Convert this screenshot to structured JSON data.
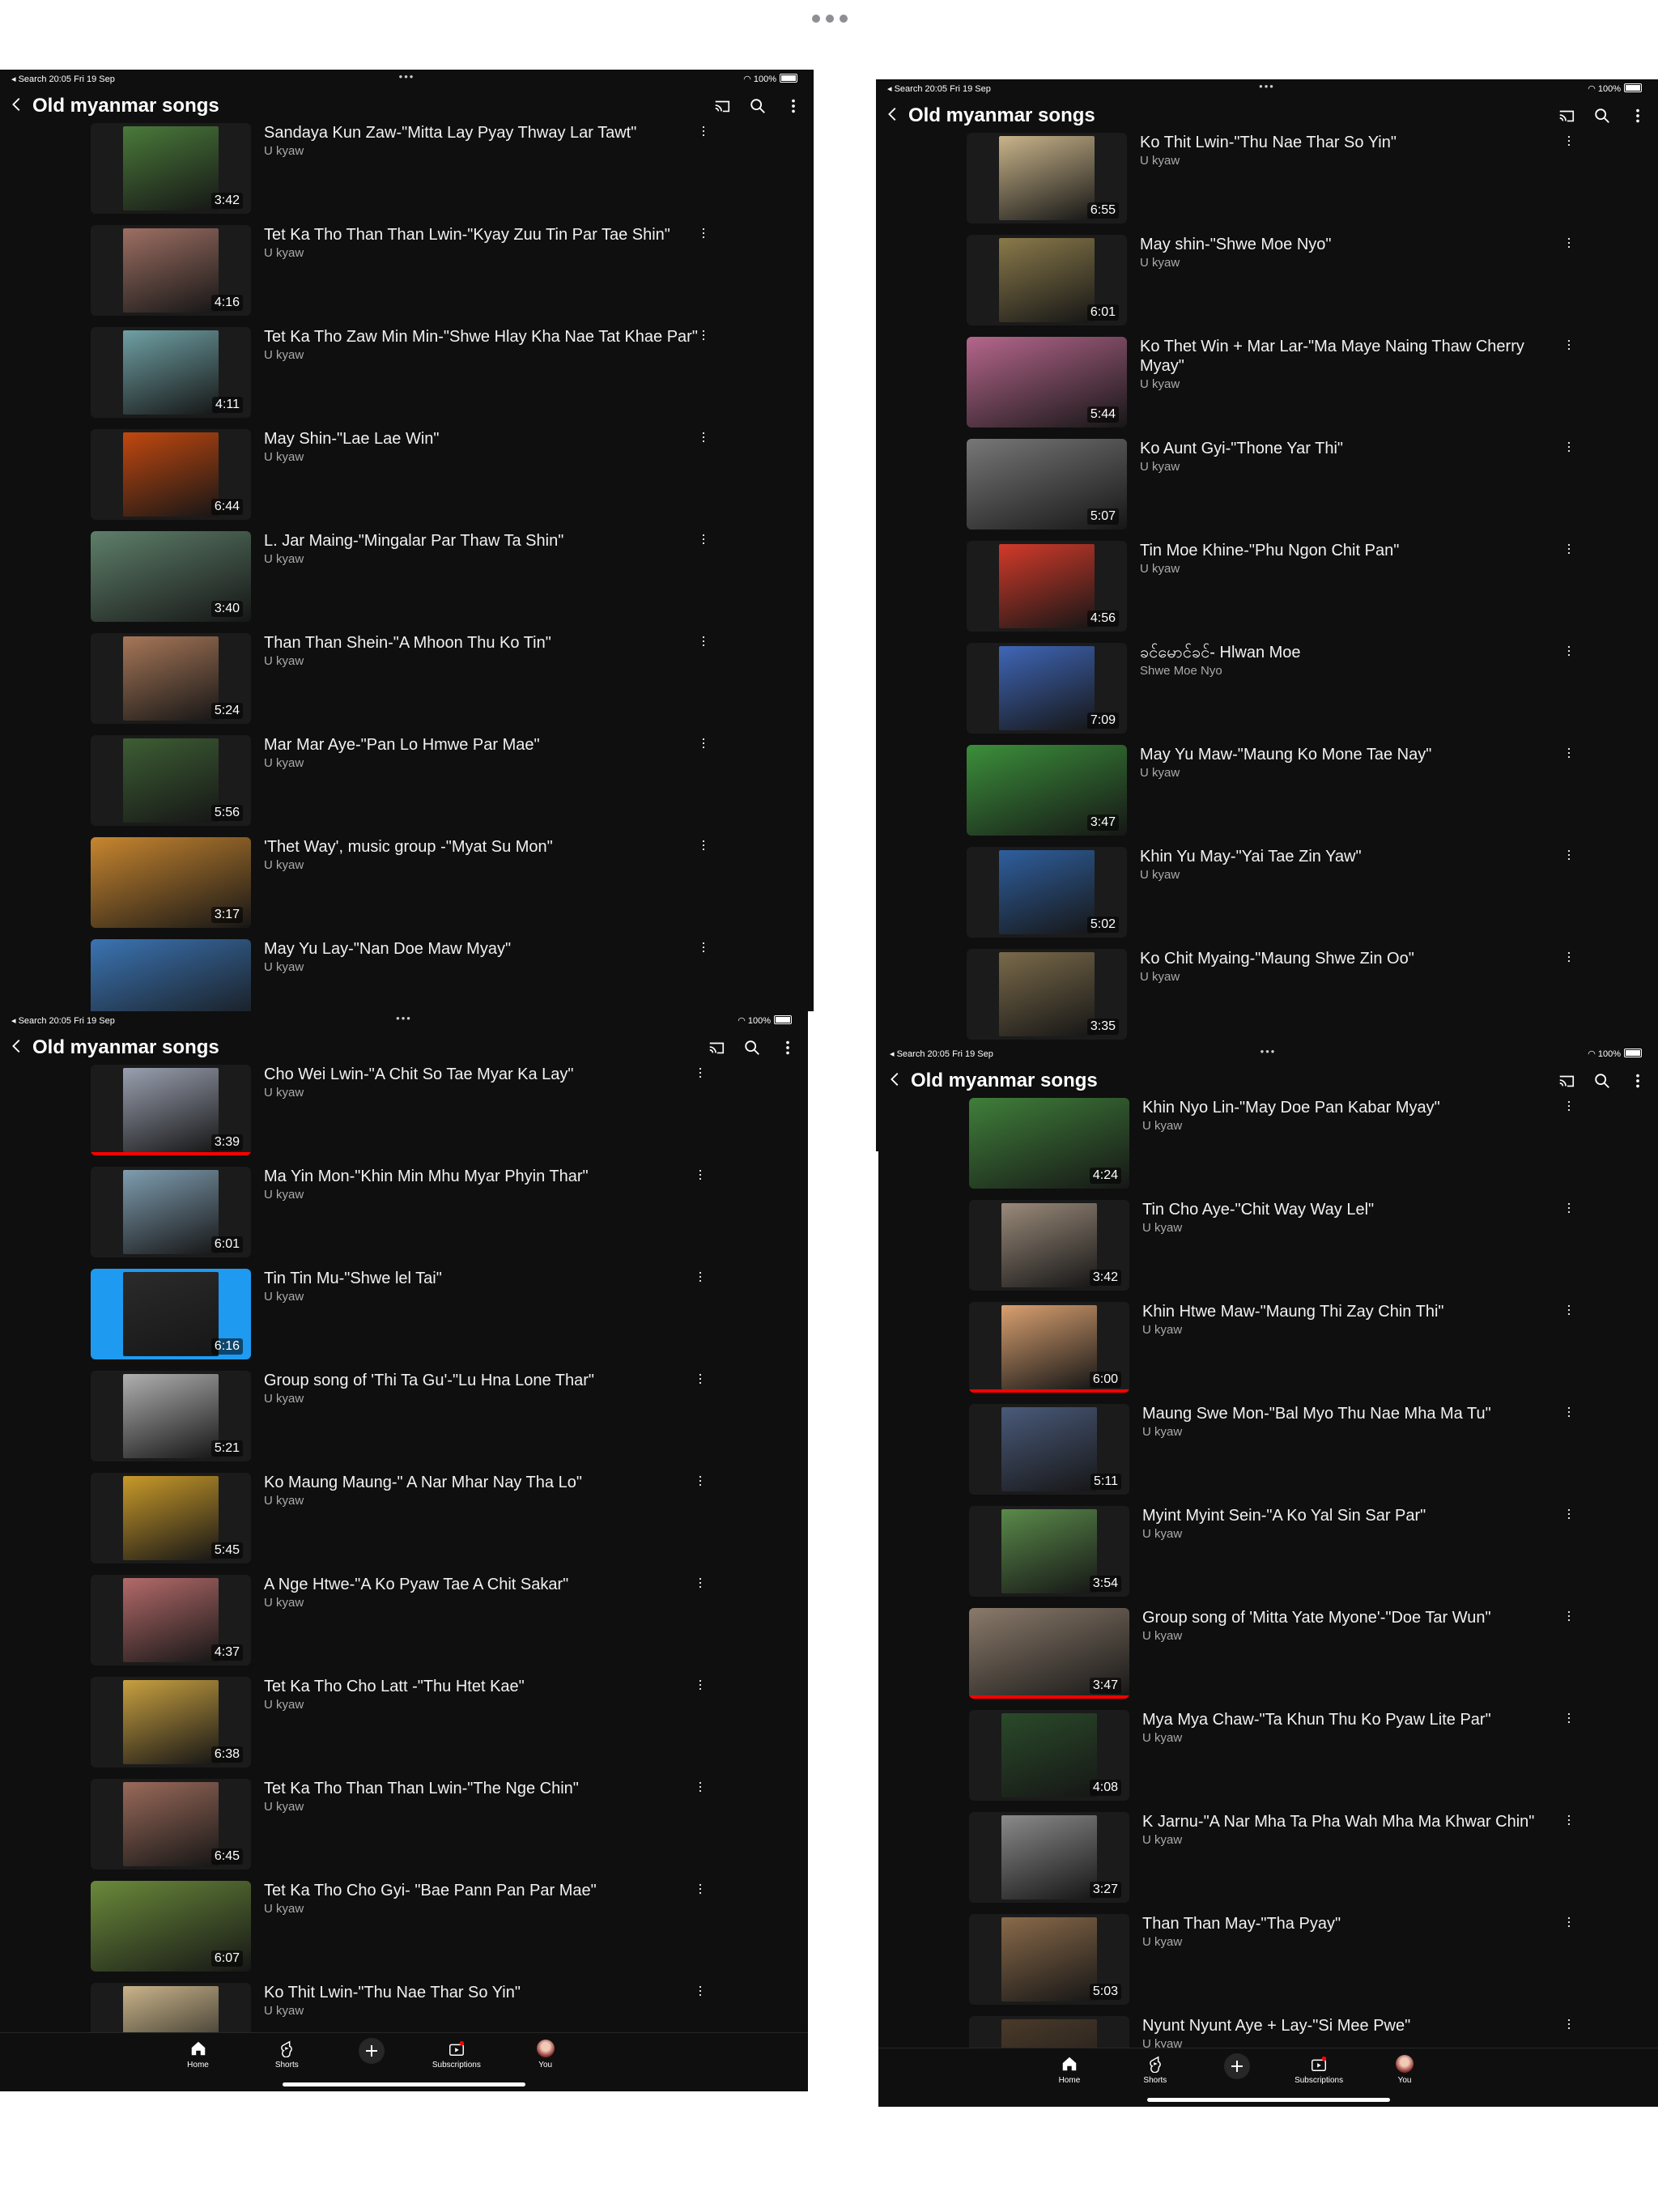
{
  "status": {
    "back_app": "◂ Search",
    "time": "20:05",
    "date": "Fri 19 Sep",
    "battery": "100%"
  },
  "playlist_title": "Old myanmar songs",
  "tabs": [
    {
      "label": "Home",
      "icon": "home-icon"
    },
    {
      "label": "Shorts",
      "icon": "shorts-icon"
    },
    {
      "label": "",
      "icon": "create-icon"
    },
    {
      "label": "Subscriptions",
      "icon": "subscriptions-icon"
    },
    {
      "label": "You",
      "icon": "avatar-icon"
    }
  ],
  "panels": [
    {
      "videos": [
        {
          "title": "Sandaya Kun Zaw-\"Mitta Lay Pyay Thway Lar Tawt\"",
          "channel": "U kyaw",
          "duration": "3:42",
          "color": "#4a7a3a"
        },
        {
          "title": "Tet Ka Tho Than Than Lwin-\"Kyay Zuu Tin Par Tae Shin\"",
          "channel": "U kyaw",
          "duration": "4:16",
          "color": "#9d6f63"
        },
        {
          "title": "Tet Ka Tho Zaw Min Min-\"Shwe Hlay Kha Nae Tat Khae Par\"",
          "channel": "U kyaw",
          "duration": "4:11",
          "color": "#6fa0a4"
        },
        {
          "title": "May Shin-\"Lae Lae Win\"",
          "channel": "U kyaw",
          "duration": "6:44",
          "color": "#c2480f"
        },
        {
          "title": "L. Jar Maing-\"Mingalar Par Thaw Ta Shin\"",
          "channel": "U kyaw",
          "duration": "3:40",
          "color": "#5e7f6a",
          "wide": true
        },
        {
          "title": "Than Than Shein-\"A Mhoon Thu Ko Tin\"",
          "channel": "U kyaw",
          "duration": "5:24",
          "color": "#a77758"
        },
        {
          "title": "Mar Mar Aye-\"Pan Lo Hmwe Par Mae\"",
          "channel": "U kyaw",
          "duration": "5:56",
          "color": "#3d5e34"
        },
        {
          "title": "'Thet Way', music group -\"Myat Su Mon\"",
          "channel": "U kyaw",
          "duration": "3:17",
          "color": "#c8862f",
          "wide": true
        },
        {
          "title": "May Yu Lay-\"Nan Doe Maw Myay\"",
          "channel": "U kyaw",
          "duration": "",
          "color": "#3b74b3",
          "wide": true
        }
      ]
    },
    {
      "videos": [
        {
          "title": "Ko Thit Lwin-\"Thu Nae Thar So Yin\"",
          "channel": "U kyaw",
          "duration": "6:55",
          "color": "#c9b48a"
        },
        {
          "title": "May shin-\"Shwe Moe Nyo\"",
          "channel": "U kyaw",
          "duration": "6:01",
          "color": "#8a7a4a"
        },
        {
          "title": "Ko Thet Win + Mar Lar-\"Ma Maye Naing Thaw Cherry Myay\"",
          "channel": "U kyaw",
          "duration": "5:44",
          "color": "#b5668c",
          "wide": true
        },
        {
          "title": "Ko Aunt Gyi-\"Thone Yar Thi\"",
          "channel": "U kyaw",
          "duration": "5:07",
          "color": "#777777",
          "wide": true
        },
        {
          "title": "Tin Moe Khine-\"Phu Ngon Chit Pan\"",
          "channel": "U kyaw",
          "duration": "4:56",
          "color": "#d23a2a"
        },
        {
          "title": "ခင်မောင်ခင်- Hlwan Moe",
          "channel": "Shwe Moe Nyo",
          "duration": "7:09",
          "color": "#3f66b7"
        },
        {
          "title": "May Yu Maw-\"Maung Ko Mone Tae Nay\"",
          "channel": "U kyaw",
          "duration": "3:47",
          "color": "#3b8f3b",
          "wide": true
        },
        {
          "title": "Khin Yu May-\"Yai Tae Zin Yaw\"",
          "channel": "U kyaw",
          "duration": "5:02",
          "color": "#2f5f9e"
        },
        {
          "title": "Ko Chit Myaing-\"Maung Shwe Zin Oo\"",
          "channel": "U kyaw",
          "duration": "3:35",
          "color": "#7a6a4a"
        }
      ]
    },
    {
      "videos": [
        {
          "title": "Cho Wei Lwin-\"A Chit So Tae Myar Ka Lay\"",
          "channel": "U kyaw",
          "duration": "3:39",
          "color": "#9aa0b0",
          "progress": 1.0
        },
        {
          "title": "Ma Yin Mon-\"Khin Min Mhu Myar Phyin Thar\"",
          "channel": "U kyaw",
          "duration": "6:01",
          "color": "#7f9db0"
        },
        {
          "title": "Tin Tin Mu-\"Shwe lel Tai\"",
          "channel": "U kyaw",
          "duration": "6:16",
          "color": "#2b2b2b",
          "highlight": true
        },
        {
          "title": "Group song of 'Thi Ta Gu'-\"Lu Hna Lone Thar\"",
          "channel": "U kyaw",
          "duration": "5:21",
          "color": "#b0b0b0"
        },
        {
          "title": "Ko Maung Maung-\" A Nar Mhar Nay Tha Lo\"",
          "channel": "U kyaw",
          "duration": "5:45",
          "color": "#c99a2a"
        },
        {
          "title": "A Nge Htwe-\"A Ko Pyaw Tae A Chit Sakar\"",
          "channel": "U kyaw",
          "duration": "4:37",
          "color": "#b46a6a"
        },
        {
          "title": "Tet Ka Tho Cho Latt -\"Thu Htet Kae\"",
          "channel": "U kyaw",
          "duration": "6:38",
          "color": "#c8a040"
        },
        {
          "title": "Tet Ka Tho Than Than Lwin-\"The Nge Chin\"",
          "channel": "U kyaw",
          "duration": "6:45",
          "color": "#9a6a5a"
        },
        {
          "title": "Tet Ka Tho Cho Gyi- \"Bae Pann Pan Par Mae\"",
          "channel": "U kyaw",
          "duration": "6:07",
          "color": "#6a8a3a",
          "wide": true
        },
        {
          "title": "Ko Thit Lwin-\"Thu Nae Thar So Yin\"",
          "channel": "U kyaw",
          "duration": "",
          "color": "#c9b48a"
        }
      ]
    },
    {
      "videos": [
        {
          "title": "Khin Nyo Lin-\"May Doe Pan Kabar Myay\"",
          "channel": "U kyaw",
          "duration": "4:24",
          "color": "#3f7f3a",
          "wide": true
        },
        {
          "title": "Tin Cho Aye-\"Chit Way Way Lel\"",
          "channel": "U kyaw",
          "duration": "3:42",
          "color": "#9a8a7a"
        },
        {
          "title": "Khin Htwe Maw-\"Maung Thi Zay Chin Thi\"",
          "channel": "U kyaw",
          "duration": "6:00",
          "color": "#d9a070",
          "progress": 1.0
        },
        {
          "title": "Maung Swe Mon-\"Bal Myo Thu Nae Mha Ma Tu\"",
          "channel": "U kyaw",
          "duration": "5:11",
          "color": "#4a5a7a"
        },
        {
          "title": "Myint Myint Sein-\"A Ko Yal Sin Sar Par\"",
          "channel": "U kyaw",
          "duration": "3:54",
          "color": "#5a8a4a"
        },
        {
          "title": "Group song of 'Mitta Yate Myone'-\"Doe Tar Wun\"",
          "channel": "U kyaw",
          "duration": "3:47",
          "color": "#8a7a6a",
          "wide": true,
          "progress": 1.0
        },
        {
          "title": "Mya Mya Chaw-\"Ta Khun Thu Ko Pyaw Lite Par\"",
          "channel": "U kyaw",
          "duration": "4:08",
          "color": "#2a4a2a"
        },
        {
          "title": "K Jarnu-\"A Nar Mha Ta Pha Wah Mha Ma Khwar Chin\"",
          "channel": "U kyaw",
          "duration": "3:27",
          "color": "#8a8a8a"
        },
        {
          "title": "Than Than May-\"Tha Pyay\"",
          "channel": "U kyaw",
          "duration": "5:03",
          "color": "#8a6a4a"
        },
        {
          "title": "Nyunt Nyunt Aye + Lay-\"Si Mee Pwe\"",
          "channel": "U kyaw",
          "duration": "",
          "color": "#4a3a2a"
        }
      ]
    }
  ]
}
